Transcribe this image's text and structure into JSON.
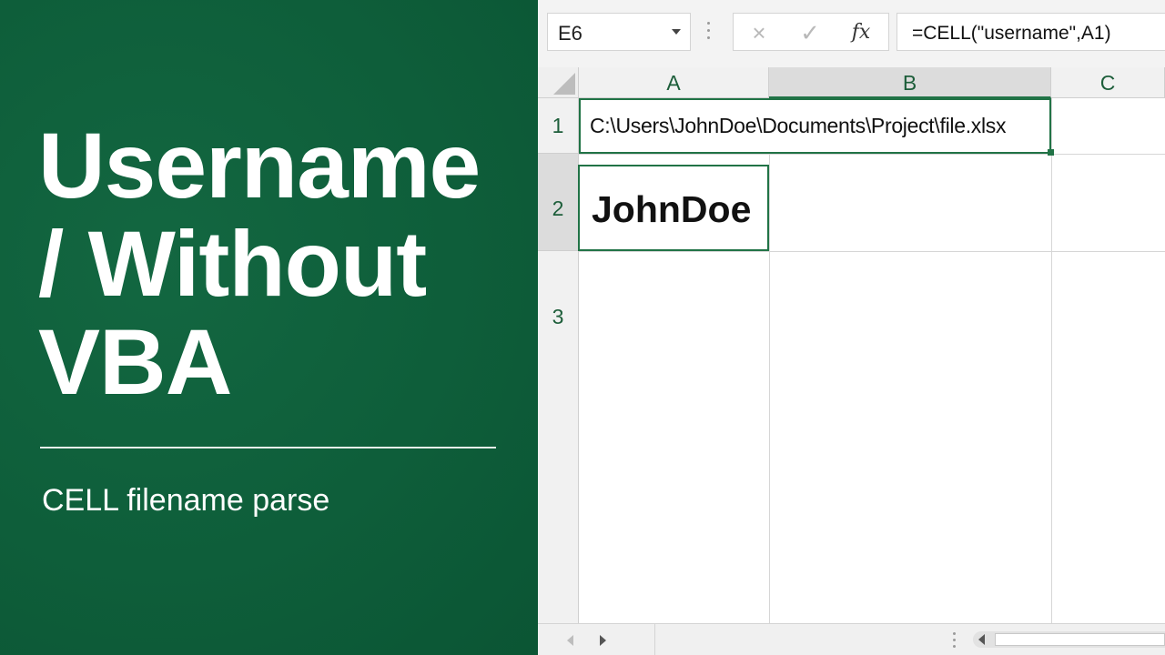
{
  "hero": {
    "title_lines": [
      "Username",
      "/ Without",
      "VBA"
    ],
    "subtitle": "CELL filename parse",
    "background_color": "#0e5e3a"
  },
  "excel": {
    "name_box": {
      "value": "E6"
    },
    "formula_bar": {
      "cancel_icon": "×",
      "enter_icon": "✓",
      "fx_label": "fx",
      "formula": "=CELL(\"username\",A1)"
    },
    "columns": [
      "A",
      "B",
      "C"
    ],
    "rows": [
      "1",
      "2",
      "3"
    ],
    "cells": {
      "A1": "C:\\Users\\JohnDoe\\Documents\\Project\\file.xlsx",
      "A2": "JohnDoe"
    },
    "accent_color": "#217346"
  }
}
